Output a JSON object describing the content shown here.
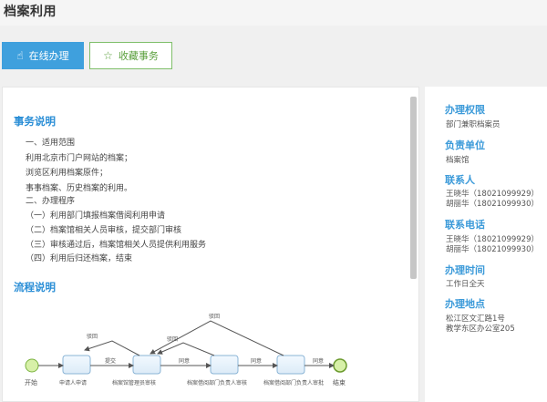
{
  "header": {
    "title": "档案利用"
  },
  "actions": {
    "online_label": "在线办理",
    "favorite_label": "收藏事务"
  },
  "main": {
    "description_title": "事务说明",
    "description_lines": [
      "一、适用范围",
      "利用北京市门户网站的档案；",
      "浏览区利用档案原件；",
      "事事档案、历史档案的利用。",
      "二、办理程序",
      "（一）利用部门填报档案借阅利用申请",
      "（二）档案馆相关人员审核，提交部门审核",
      "（三）审核通过后，档案馆相关人员提供利用服务",
      "（四）利用后归还档案，结束"
    ],
    "flow_title": "流程说明",
    "flow": {
      "start": "开始",
      "end": "结束",
      "nodes": [
        "申请人申请",
        "档案馆管理员审核",
        "档案借阅部门负责人审核",
        "档案借阅部门负责人审批"
      ],
      "edges": {
        "submit": "提交",
        "reject1": "驳回",
        "reject2": "驳回",
        "reject3": "驳回",
        "agree1": "同意",
        "agree2": "同意",
        "agree3": "同意"
      }
    }
  },
  "sidebar": {
    "authority_title": "办理权限",
    "authority_text": "部门兼职档案员",
    "unit_title": "负责单位",
    "unit_text": "档案馆",
    "contact_title": "联系人",
    "contact_lines": [
      "王晓华（18021099929）",
      "胡丽华（18021099930）"
    ],
    "phone_title": "联系电话",
    "phone_lines": [
      "王晓华（18021099929）",
      "胡丽华（18021099930）"
    ],
    "time_title": "办理时间",
    "time_text": "工作日全天",
    "place_title": "办理地点",
    "place_lines": [
      "松江区文汇路1号",
      "教学东区办公室205"
    ]
  },
  "colors": {
    "accent": "#3fa0dd",
    "section_title": "#2a8ed6",
    "favorite": "#5a9f3c"
  }
}
